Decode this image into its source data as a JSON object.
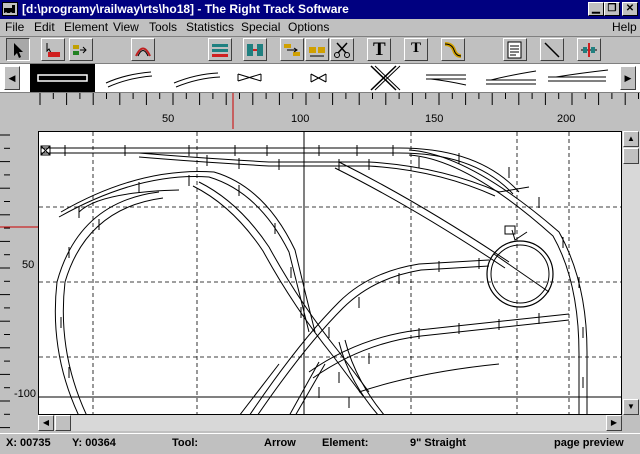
{
  "window": {
    "title": "[d:\\programy\\railway\\rts\\ho18] - The Right Track Software",
    "minimize_glyph": "▁",
    "restore_glyph": "❐",
    "close_glyph": "✕"
  },
  "menu": {
    "file": "File",
    "edit": "Edit",
    "element": "Element",
    "view": "View",
    "tools": "Tools",
    "statistics": "Statistics",
    "special": "Special",
    "options": "Options",
    "help": "Help"
  },
  "toolbar": {
    "text_tool_glyph": "T",
    "text_tool_alt_glyph": "T"
  },
  "palette": {
    "left_arrow": "◀",
    "right_arrow": "▶"
  },
  "ruler": {
    "h_labels": [
      "50",
      "100",
      "150",
      "200"
    ],
    "v_labels": [
      "50",
      "-100"
    ]
  },
  "scroll": {
    "up": "▲",
    "down": "▼",
    "left": "◀",
    "right": "▶"
  },
  "status": {
    "x_label": "X: 00735",
    "y_label": "Y: 00364",
    "tool_label": "Tool:",
    "tool_value": "Arrow",
    "element_label": "Element:",
    "element_value": "9\" Straight",
    "preview_label": "page preview"
  },
  "colors": {
    "titlebar": "#000080",
    "window_bg": "#c0c0c0",
    "canvas_bg": "#ffffff",
    "cursor_marker": "#cc0000"
  }
}
